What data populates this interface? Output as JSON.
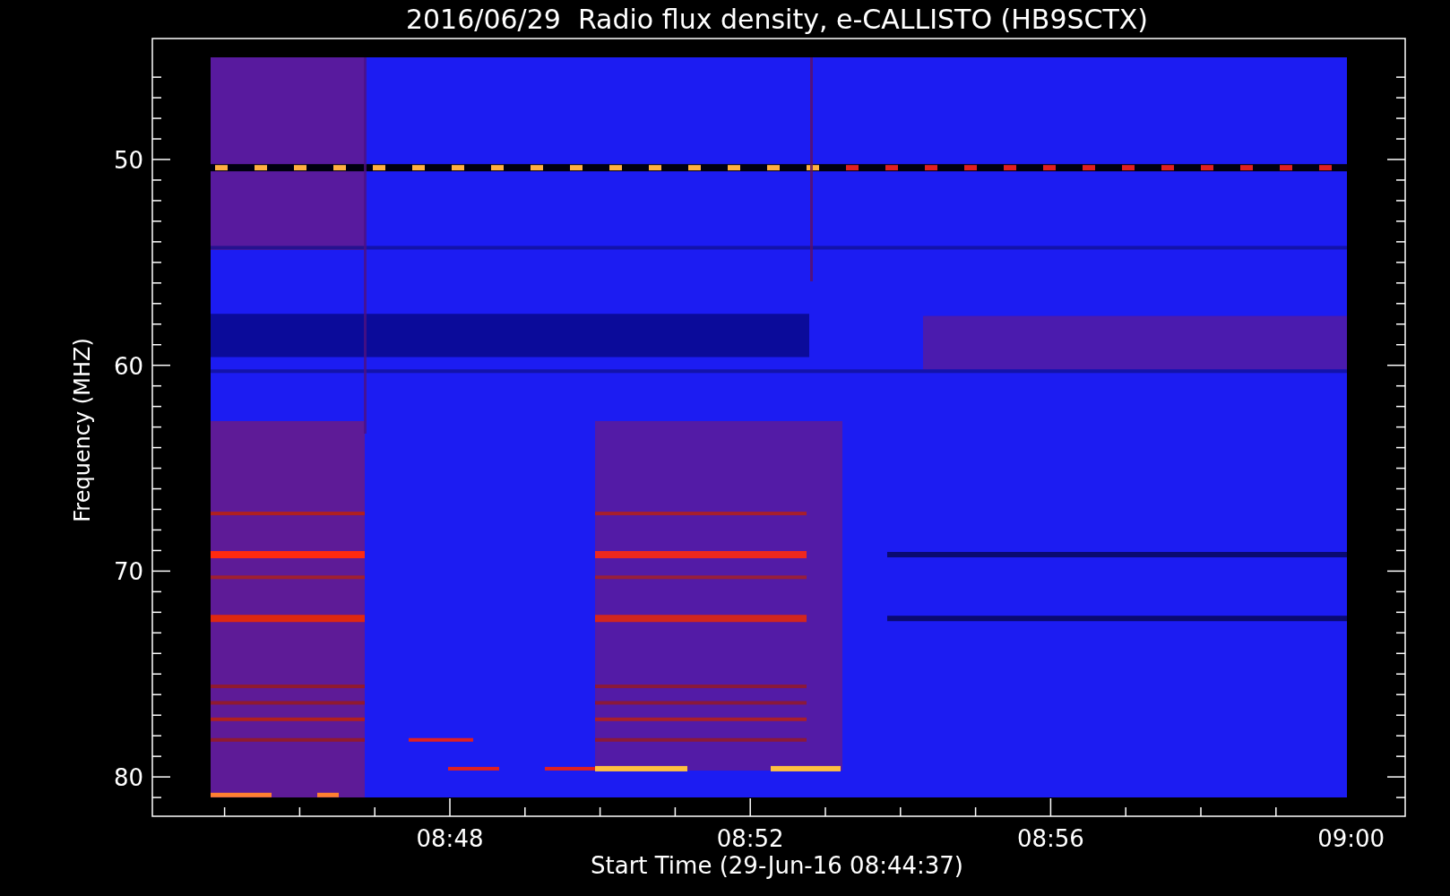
{
  "title": "2016/06/29  Radio flux density, e-CALLISTO (HB9SCTX)",
  "y_axis": {
    "label": "Frequency (MHZ)",
    "ticks": [
      "50",
      "60",
      "70",
      "80"
    ]
  },
  "x_axis": {
    "label": "Start Time (29-Jun-16 08:44:37)",
    "ticks": [
      "08:48",
      "08:52",
      "08:56",
      "09:00"
    ]
  }
}
